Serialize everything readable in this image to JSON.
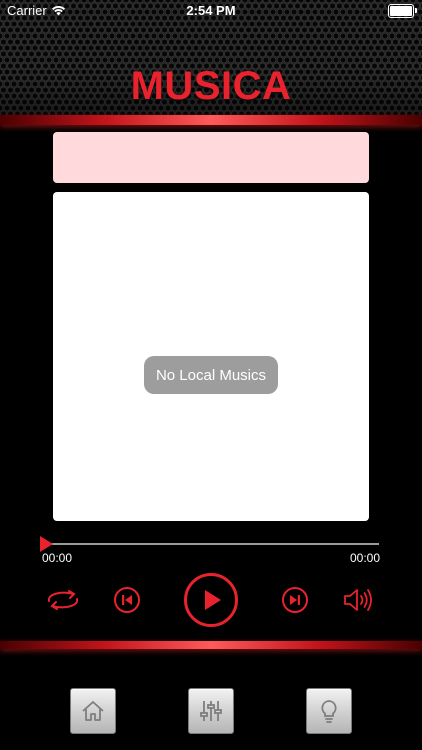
{
  "status_bar": {
    "carrier": "Carrier",
    "time": "2:54 PM",
    "battery_level": 1.0
  },
  "app": {
    "title": "MUSICA"
  },
  "list": {
    "empty_message": "No Local Musics"
  },
  "player": {
    "current_time": "00:00",
    "total_time": "00:00",
    "progress": 0,
    "accent_color": "#e8232e"
  },
  "controls": {
    "repeat_icon": "repeat-icon",
    "previous_icon": "skip-previous-icon",
    "play_icon": "play-icon",
    "next_icon": "skip-next-icon",
    "volume_icon": "volume-icon"
  },
  "dock": {
    "items": [
      {
        "icon": "home-icon"
      },
      {
        "icon": "equalizer-icon"
      },
      {
        "icon": "lightbulb-icon"
      }
    ]
  }
}
